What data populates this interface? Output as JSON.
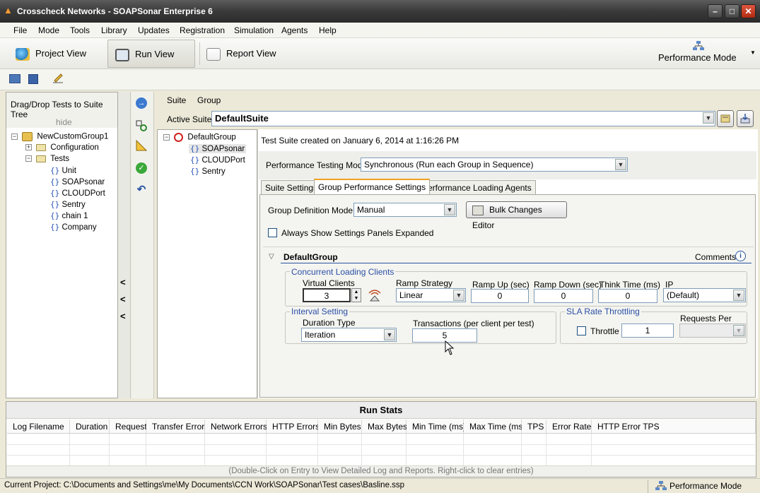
{
  "window": {
    "title": "Crosscheck Networks - SOAPSonar Enterprise 6",
    "minimize": "–",
    "maximize": "□",
    "close": "✕"
  },
  "menu": [
    "File",
    "Mode",
    "Tools",
    "Library",
    "Updates",
    "Registration",
    "Simulation",
    "Agents",
    "Help"
  ],
  "views": {
    "project": "Project View",
    "run": "Run View",
    "report": "Report View",
    "mode": "Performance Mode"
  },
  "left_panel": {
    "heading": "Drag/Drop Tests to Suite Tree",
    "hide": "hide",
    "root": "NewCustomGroup1",
    "configuration": "Configuration",
    "tests": "Tests",
    "items": [
      "Unit",
      "SOAPsonar",
      "CLOUDPort",
      "Sentry",
      "chain 1",
      "Company"
    ]
  },
  "collapse_arrows": [
    "<",
    "<",
    "<"
  ],
  "suite": {
    "menu_suite": "Suite",
    "menu_group": "Group",
    "active_label": "Active Suite:",
    "active_value": "DefaultSuite",
    "tree_root": "DefaultGroup",
    "tree_items": [
      "SOAPsonar",
      "CLOUDPort",
      "Sentry"
    ]
  },
  "main": {
    "created": "Test Suite created on January 6, 2014 at 1:16:26 PM",
    "perf_mode_label": "Performance Testing Mode",
    "perf_mode_value": "Synchronous (Run each Group in Sequence)",
    "tabs": [
      "Suite Settings",
      "Group Performance Settings",
      "Performance Loading Agents"
    ],
    "group_def_label": "Group Definition Mode:",
    "group_def_value": "Manual",
    "bulk_button": "Bulk Changes Editor",
    "always_show": "Always Show Settings Panels Expanded",
    "group_name": "DefaultGroup",
    "comments": "Comments",
    "concurrent": {
      "title": "Concurrent Loading Clients",
      "virtual_clients_label": "Virtual Clients",
      "virtual_clients_value": "3",
      "ramp_strategy_label": "Ramp Strategy",
      "ramp_strategy_value": "Linear",
      "ramp_up_label": "Ramp Up (sec)",
      "ramp_up_value": "0",
      "ramp_down_label": "Ramp Down (sec)",
      "ramp_down_value": "0",
      "think_label": "Think Time (ms)",
      "think_value": "0",
      "ip_label": "IP",
      "ip_value": "(Default)"
    },
    "interval": {
      "title": "Interval Setting",
      "duration_label": "Duration Type",
      "duration_value": "Iteration",
      "transactions_label": "Transactions (per client per test)",
      "transactions_value": "5"
    },
    "sla": {
      "title": "SLA Rate Throttling",
      "throttle_label": "Throttle",
      "throttle_value": "1",
      "requests_per_label": "Requests Per"
    }
  },
  "run_stats": {
    "title": "Run Stats",
    "columns": [
      "Log Filename",
      "Duration",
      "Requests",
      "Transfer Errors",
      "Network Errors",
      "HTTP Errors",
      "Min Bytes",
      "Max Bytes",
      "Min Time (ms)",
      "Max Time (ms)",
      "TPS",
      "Error Rate",
      "HTTP Error TPS"
    ],
    "hint": "(Double-Click on Entry to View Detailed Log and Reports.  Right-click to clear entries)"
  },
  "status": {
    "project": "Current Project: C:\\Documents and Settings\\me\\My Documents\\CCN Work\\SOAPSonar\\Test cases\\Basline.ssp",
    "mode": "Performance Mode"
  }
}
